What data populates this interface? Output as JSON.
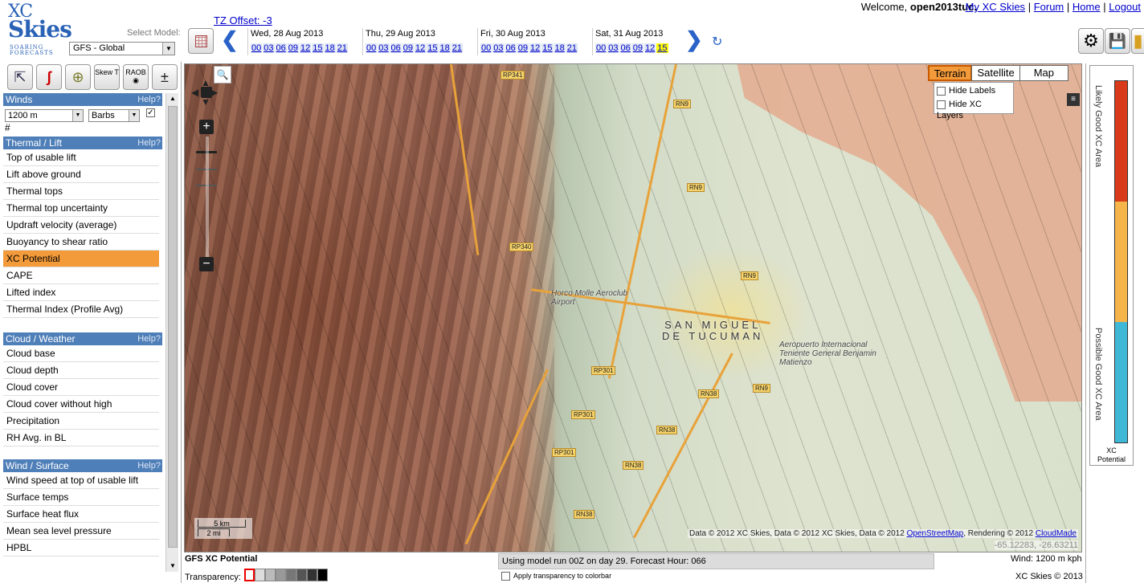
{
  "header": {
    "logo": {
      "line1": "XC",
      "line2": "Skies",
      "line3": "SOARING",
      "line4": "FORECASTS"
    },
    "select_model_label": "Select Model:",
    "model_value": "GFS - Global",
    "tz_offset": "TZ Offset: -3",
    "days": [
      {
        "label": "Wed, 28 Aug 2013",
        "hours": [
          "00",
          "03",
          "06",
          "09",
          "12",
          "15",
          "18",
          "21"
        ]
      },
      {
        "label": "Thu, 29 Aug 2013",
        "hours": [
          "00",
          "03",
          "06",
          "09",
          "12",
          "15",
          "18",
          "21"
        ]
      },
      {
        "label": "Fri, 30 Aug 2013",
        "hours": [
          "00",
          "03",
          "06",
          "09",
          "12",
          "15",
          "18",
          "21"
        ]
      },
      {
        "label": "Sat, 31 Aug 2013",
        "hours": [
          "00",
          "03",
          "06",
          "09",
          "12",
          "15"
        ]
      }
    ],
    "selected_hour": "15",
    "welcome_prefix": "Welcome,",
    "username": "open2013tuc.",
    "links": {
      "my": "My XC Skies",
      "forum": "Forum",
      "home": "Home",
      "logout": "Logout"
    }
  },
  "sidebar": {
    "tools": [
      {
        "name": "cursor-tool-icon",
        "glyph": "⇱"
      },
      {
        "name": "route-tool-icon",
        "glyph": "ʃ"
      },
      {
        "name": "target-tool-icon",
        "glyph": "⊕"
      },
      {
        "name": "skew-t-tool-icon",
        "glyph": "Skew T"
      },
      {
        "name": "raob-tool-icon",
        "glyph": "RAOB ◉"
      },
      {
        "name": "plus-minus-tool-icon",
        "glyph": "±"
      }
    ],
    "winds": {
      "title": "Winds",
      "help": "Help?",
      "level": "1200 m",
      "style": "Barbs",
      "hash": "#"
    },
    "thermal": {
      "title": "Thermal / Lift",
      "help": "Help?",
      "items": [
        "Top of usable lift",
        "Lift above ground",
        "Thermal tops",
        "Thermal top uncertainty",
        "Updraft velocity (average)",
        "Buoyancy to shear ratio",
        "XC Potential",
        "CAPE",
        "Lifted index",
        "Thermal Index (Profile Avg)"
      ],
      "selected": "XC Potential"
    },
    "cloud": {
      "title": "Cloud / Weather",
      "help": "Help?",
      "items": [
        "Cloud base",
        "Cloud depth",
        "Cloud cover",
        "Cloud cover without high",
        "Precipitation",
        "RH Avg. in BL"
      ]
    },
    "surface": {
      "title": "Wind / Surface",
      "help": "Help?",
      "items": [
        "Wind speed at top of usable lift",
        "Surface temps",
        "Surface heat flux",
        "Mean sea level pressure",
        "HPBL"
      ]
    }
  },
  "map": {
    "type_buttons": [
      "Terrain",
      "Satellite",
      "Map"
    ],
    "selected_type": "Terrain",
    "options": [
      "Hide Labels",
      "Hide XC Layers"
    ],
    "city_line1": "SAN MIGUEL",
    "city_line2": "DE TUCUMAN",
    "aeroclub": "Horco Molle Aeroclub Airport",
    "airport": "Aeropuerto Internacional Teniente General Benjamin Matienzo",
    "roads": [
      "RP341",
      "RN9",
      "RN9",
      "RN9",
      "RN9",
      "RP340",
      "RP301",
      "RP301",
      "RP301",
      "RN38",
      "RN38",
      "RN38",
      "RN38"
    ],
    "scale_km": "5 km",
    "scale_mi": "2 mi",
    "attribution_text": "Data © 2012 XC Skies, Data © 2012 XC Skies, Data © 2012 ",
    "attribution_osm": "OpenStreetMap",
    "attribution_rendering": ", Rendering © 2012 ",
    "attribution_cm": "CloudMade",
    "coords": "-65.12283, -26.63211"
  },
  "colorbar": {
    "top_label": "Likely Good XC Area",
    "bottom_label": "Possible Good XC Area",
    "caption_line1": "XC",
    "caption_line2": "Potential",
    "colors": [
      "#d83a1a",
      "#f5b54a",
      "#3fb8d8"
    ]
  },
  "footer": {
    "layer_title": "GFS XC Potential",
    "transparency_label": "Transparency:",
    "model_run": "Using model run 00Z on day 29. Forecast Hour: 066",
    "apply_transparency": "Apply transparency to colorbar",
    "wind_info": "Wind: 1200 m kph",
    "copyright": "XC Skies © 2013"
  }
}
